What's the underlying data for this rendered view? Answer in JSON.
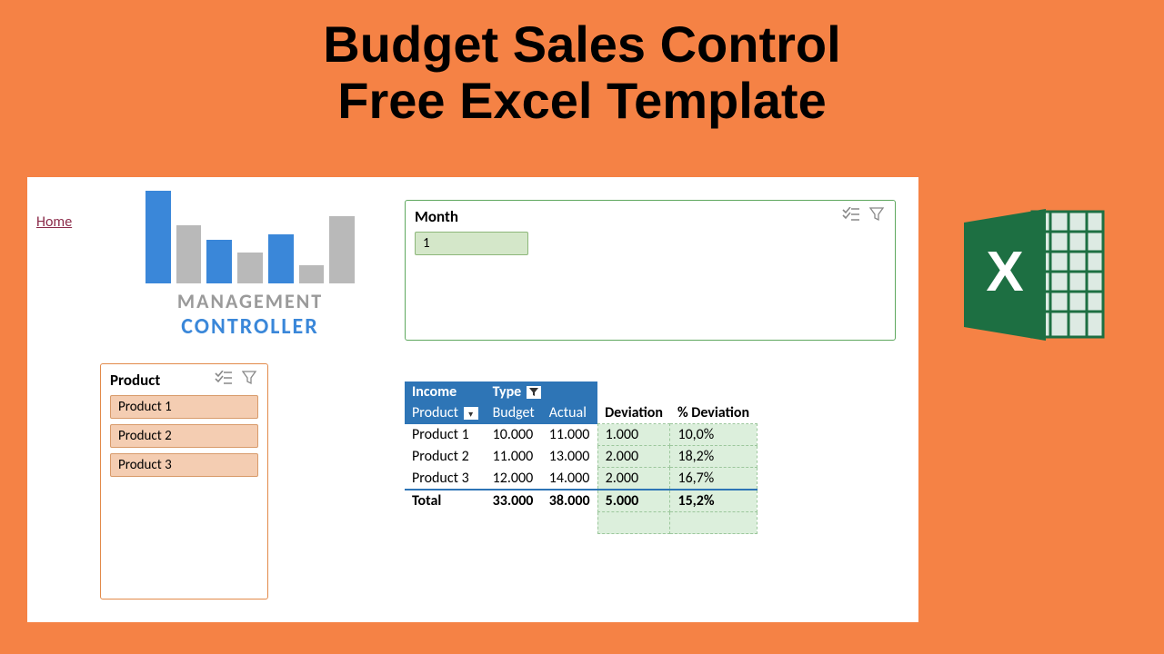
{
  "title_line1": "Budget Sales Control",
  "title_line2": "Free Excel Template",
  "home_link": "Home",
  "logo": {
    "line1": "MANAGEMENT",
    "line2": "CONTROLLER"
  },
  "slicers": {
    "month": {
      "title": "Month",
      "items": [
        "1"
      ]
    },
    "product": {
      "title": "Product",
      "items": [
        "Product 1",
        "Product 2",
        "Product 3"
      ]
    }
  },
  "pivot": {
    "income_label": "Income",
    "type_label": "Type",
    "product_label": "Product",
    "budget_label": "Budget",
    "actual_label": "Actual",
    "deviation_label": "Deviation",
    "pct_deviation_label": "% Deviation",
    "rows": [
      {
        "product": "Product 1",
        "budget": "10.000",
        "actual": "11.000",
        "deviation": "1.000",
        "pct": "10,0%"
      },
      {
        "product": "Product 2",
        "budget": "11.000",
        "actual": "13.000",
        "deviation": "2.000",
        "pct": "18,2%"
      },
      {
        "product": "Product 3",
        "budget": "12.000",
        "actual": "14.000",
        "deviation": "2.000",
        "pct": "16,7%"
      }
    ],
    "total": {
      "label": "Total",
      "budget": "33.000",
      "actual": "38.000",
      "deviation": "5.000",
      "pct": "15,2%"
    }
  },
  "chart_data": {
    "type": "bar",
    "title": "MANAGEMENT CONTROLLER",
    "categories": [
      "b1",
      "b2",
      "b3",
      "b4",
      "b5",
      "b6",
      "b7"
    ],
    "series": [
      {
        "name": "height_px",
        "values": [
          102,
          64,
          48,
          34,
          54,
          20,
          74
        ]
      },
      {
        "name": "color",
        "values": [
          "blue",
          "gray",
          "blue",
          "gray",
          "blue",
          "gray",
          "gray"
        ]
      }
    ]
  }
}
